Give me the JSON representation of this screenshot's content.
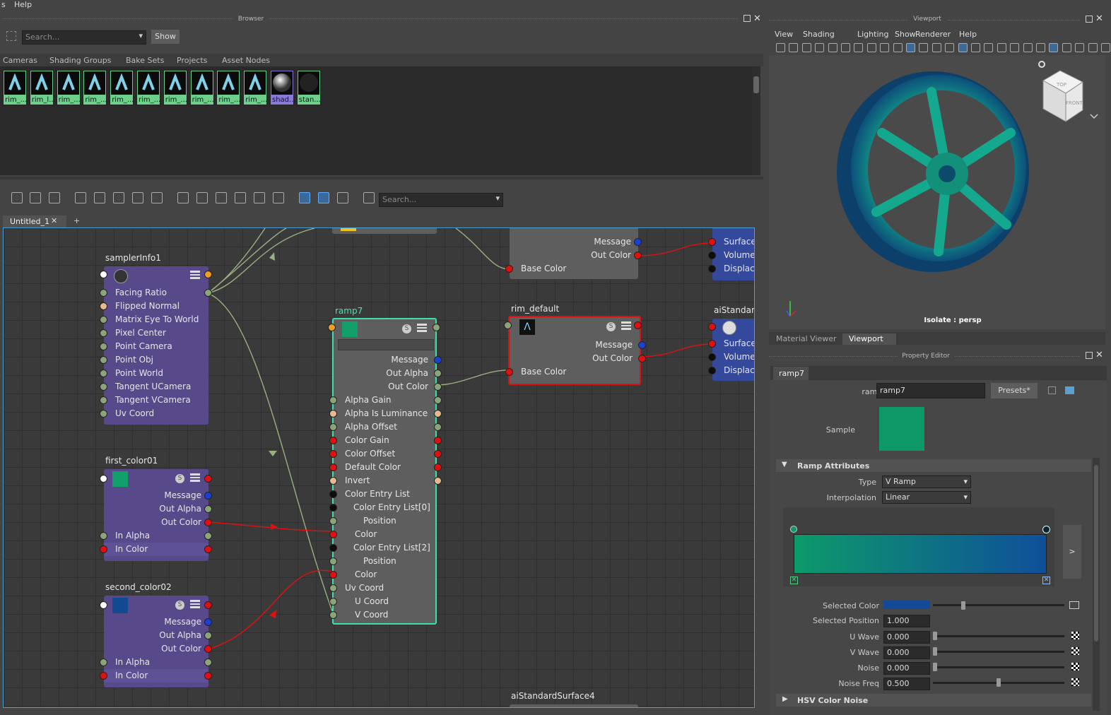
{
  "menubar": {
    "items": [
      "s",
      "Help"
    ]
  },
  "browser": {
    "title": "Browser",
    "search_placeholder": "Search...",
    "show_label": "Show",
    "tabs": [
      "Cameras",
      "Shading Groups",
      "Bake Sets",
      "Projects",
      "Asset Nodes"
    ],
    "thumbs": [
      "rim_...",
      "rim_l...",
      "rim_...",
      "rim_...",
      "rim_...",
      "rim_...",
      "rim_...",
      "rim_...",
      "rim_...",
      "rim_...",
      "shad...",
      "stan..."
    ]
  },
  "hypershade": {
    "search_placeholder": "Search...",
    "tab": "Untitled_1",
    "add_tab": "+",
    "nodes": {
      "samplerInfo": {
        "title": "samplerInfo1",
        "rows": [
          "Facing Ratio",
          "Flipped Normal",
          "Matrix Eye To World",
          "Pixel Center",
          "Point Camera",
          "Point Obj",
          "Point World",
          "Tangent UCamera",
          "Tangent VCamera",
          "Uv Coord"
        ]
      },
      "first_color": {
        "title": "first_color01",
        "rows": [
          "Message",
          "Out Alpha",
          "Out Color",
          "In Alpha",
          "In Color"
        ],
        "swatch": "#12a06a"
      },
      "second_color": {
        "title": "second_color02",
        "rows": [
          "Message",
          "Out Alpha",
          "Out Color",
          "In Alpha",
          "In Color"
        ],
        "swatch": "#114a90"
      },
      "ramp": {
        "title": "ramp7",
        "rows": [
          "Message",
          "Out Alpha",
          "Out Color",
          "Alpha Gain",
          "Alpha Is Luminance",
          "Alpha Offset",
          "Color Gain",
          "Color Offset",
          "Default Color",
          "Invert",
          "Color Entry List",
          "Color Entry List[0]",
          "Position",
          "Color",
          "Color Entry List[2]",
          "Position",
          "Color",
          "Uv Coord",
          "U Coord",
          "V Coord"
        ]
      },
      "rim_top": {
        "rows": [
          "Message",
          "Out Color",
          "Base Color"
        ]
      },
      "rim_default": {
        "title": "rim_default",
        "rows": [
          "Message",
          "Out Color",
          "Base Color"
        ]
      },
      "ai_top": {
        "rows": [
          "Surface",
          "Volume",
          "Displace"
        ]
      },
      "ai_std": {
        "title": "aiStandar",
        "rows": [
          "Surface",
          "Volume",
          "Displace"
        ]
      },
      "ai_bottom": {
        "title": "aiStandardSurface4"
      }
    }
  },
  "viewport": {
    "title": "Viewport",
    "menu": [
      "View",
      "Shading",
      "Lighting",
      "Show",
      "Renderer",
      "Help"
    ],
    "isolate_label": "Isolate : persp",
    "cube_top": "TOP",
    "cube_front": "FRONT",
    "tabs": [
      "Material Viewer",
      "Viewport"
    ]
  },
  "property_editor": {
    "title": "Property Editor",
    "tab": "ramp7",
    "ramp_label": "ramp:",
    "ramp_value": "ramp7",
    "presets_label": "Presets*",
    "sample_label": "Sample",
    "sample_color": "#0e9868",
    "section_ramp": "Ramp Attributes",
    "type_label": "Type",
    "type_value": "V Ramp",
    "interp_label": "Interpolation",
    "interp_value": "Linear",
    "ramp_colors": [
      "#0d9a6a",
      "#0f4f9a"
    ],
    "ramp_arrow": ">",
    "selected_color_label": "Selected Color",
    "selected_color": "#134a98",
    "selected_position_label": "Selected Position",
    "selected_position": "1.000",
    "u_wave_label": "U Wave",
    "u_wave": "0.000",
    "v_wave_label": "V Wave",
    "v_wave": "0.000",
    "noise_label": "Noise",
    "noise": "0.000",
    "noise_freq_label": "Noise Freq",
    "noise_freq": "0.500",
    "section_hsv": "HSV Color Noise"
  }
}
